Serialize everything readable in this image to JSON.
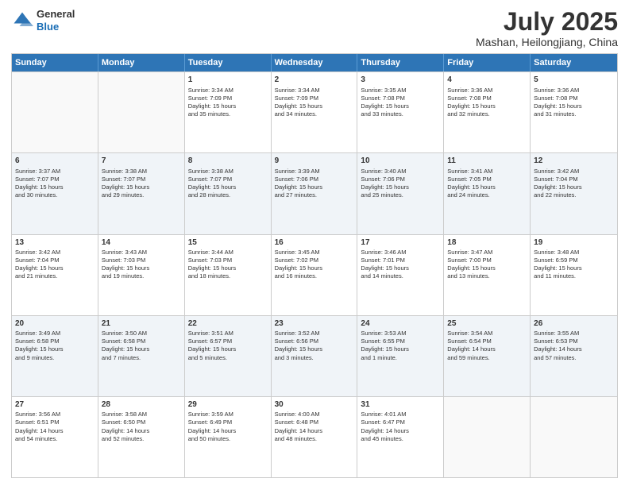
{
  "header": {
    "logo_general": "General",
    "logo_blue": "Blue",
    "month": "July 2025",
    "location": "Mashan, Heilongjiang, China"
  },
  "weekdays": [
    "Sunday",
    "Monday",
    "Tuesday",
    "Wednesday",
    "Thursday",
    "Friday",
    "Saturday"
  ],
  "rows": [
    [
      {
        "day": "",
        "info": ""
      },
      {
        "day": "",
        "info": ""
      },
      {
        "day": "1",
        "info": "Sunrise: 3:34 AM\nSunset: 7:09 PM\nDaylight: 15 hours\nand 35 minutes."
      },
      {
        "day": "2",
        "info": "Sunrise: 3:34 AM\nSunset: 7:09 PM\nDaylight: 15 hours\nand 34 minutes."
      },
      {
        "day": "3",
        "info": "Sunrise: 3:35 AM\nSunset: 7:08 PM\nDaylight: 15 hours\nand 33 minutes."
      },
      {
        "day": "4",
        "info": "Sunrise: 3:36 AM\nSunset: 7:08 PM\nDaylight: 15 hours\nand 32 minutes."
      },
      {
        "day": "5",
        "info": "Sunrise: 3:36 AM\nSunset: 7:08 PM\nDaylight: 15 hours\nand 31 minutes."
      }
    ],
    [
      {
        "day": "6",
        "info": "Sunrise: 3:37 AM\nSunset: 7:07 PM\nDaylight: 15 hours\nand 30 minutes."
      },
      {
        "day": "7",
        "info": "Sunrise: 3:38 AM\nSunset: 7:07 PM\nDaylight: 15 hours\nand 29 minutes."
      },
      {
        "day": "8",
        "info": "Sunrise: 3:38 AM\nSunset: 7:07 PM\nDaylight: 15 hours\nand 28 minutes."
      },
      {
        "day": "9",
        "info": "Sunrise: 3:39 AM\nSunset: 7:06 PM\nDaylight: 15 hours\nand 27 minutes."
      },
      {
        "day": "10",
        "info": "Sunrise: 3:40 AM\nSunset: 7:06 PM\nDaylight: 15 hours\nand 25 minutes."
      },
      {
        "day": "11",
        "info": "Sunrise: 3:41 AM\nSunset: 7:05 PM\nDaylight: 15 hours\nand 24 minutes."
      },
      {
        "day": "12",
        "info": "Sunrise: 3:42 AM\nSunset: 7:04 PM\nDaylight: 15 hours\nand 22 minutes."
      }
    ],
    [
      {
        "day": "13",
        "info": "Sunrise: 3:42 AM\nSunset: 7:04 PM\nDaylight: 15 hours\nand 21 minutes."
      },
      {
        "day": "14",
        "info": "Sunrise: 3:43 AM\nSunset: 7:03 PM\nDaylight: 15 hours\nand 19 minutes."
      },
      {
        "day": "15",
        "info": "Sunrise: 3:44 AM\nSunset: 7:03 PM\nDaylight: 15 hours\nand 18 minutes."
      },
      {
        "day": "16",
        "info": "Sunrise: 3:45 AM\nSunset: 7:02 PM\nDaylight: 15 hours\nand 16 minutes."
      },
      {
        "day": "17",
        "info": "Sunrise: 3:46 AM\nSunset: 7:01 PM\nDaylight: 15 hours\nand 14 minutes."
      },
      {
        "day": "18",
        "info": "Sunrise: 3:47 AM\nSunset: 7:00 PM\nDaylight: 15 hours\nand 13 minutes."
      },
      {
        "day": "19",
        "info": "Sunrise: 3:48 AM\nSunset: 6:59 PM\nDaylight: 15 hours\nand 11 minutes."
      }
    ],
    [
      {
        "day": "20",
        "info": "Sunrise: 3:49 AM\nSunset: 6:58 PM\nDaylight: 15 hours\nand 9 minutes."
      },
      {
        "day": "21",
        "info": "Sunrise: 3:50 AM\nSunset: 6:58 PM\nDaylight: 15 hours\nand 7 minutes."
      },
      {
        "day": "22",
        "info": "Sunrise: 3:51 AM\nSunset: 6:57 PM\nDaylight: 15 hours\nand 5 minutes."
      },
      {
        "day": "23",
        "info": "Sunrise: 3:52 AM\nSunset: 6:56 PM\nDaylight: 15 hours\nand 3 minutes."
      },
      {
        "day": "24",
        "info": "Sunrise: 3:53 AM\nSunset: 6:55 PM\nDaylight: 15 hours\nand 1 minute."
      },
      {
        "day": "25",
        "info": "Sunrise: 3:54 AM\nSunset: 6:54 PM\nDaylight: 14 hours\nand 59 minutes."
      },
      {
        "day": "26",
        "info": "Sunrise: 3:55 AM\nSunset: 6:53 PM\nDaylight: 14 hours\nand 57 minutes."
      }
    ],
    [
      {
        "day": "27",
        "info": "Sunrise: 3:56 AM\nSunset: 6:51 PM\nDaylight: 14 hours\nand 54 minutes."
      },
      {
        "day": "28",
        "info": "Sunrise: 3:58 AM\nSunset: 6:50 PM\nDaylight: 14 hours\nand 52 minutes."
      },
      {
        "day": "29",
        "info": "Sunrise: 3:59 AM\nSunset: 6:49 PM\nDaylight: 14 hours\nand 50 minutes."
      },
      {
        "day": "30",
        "info": "Sunrise: 4:00 AM\nSunset: 6:48 PM\nDaylight: 14 hours\nand 48 minutes."
      },
      {
        "day": "31",
        "info": "Sunrise: 4:01 AM\nSunset: 6:47 PM\nDaylight: 14 hours\nand 45 minutes."
      },
      {
        "day": "",
        "info": ""
      },
      {
        "day": "",
        "info": ""
      }
    ]
  ]
}
